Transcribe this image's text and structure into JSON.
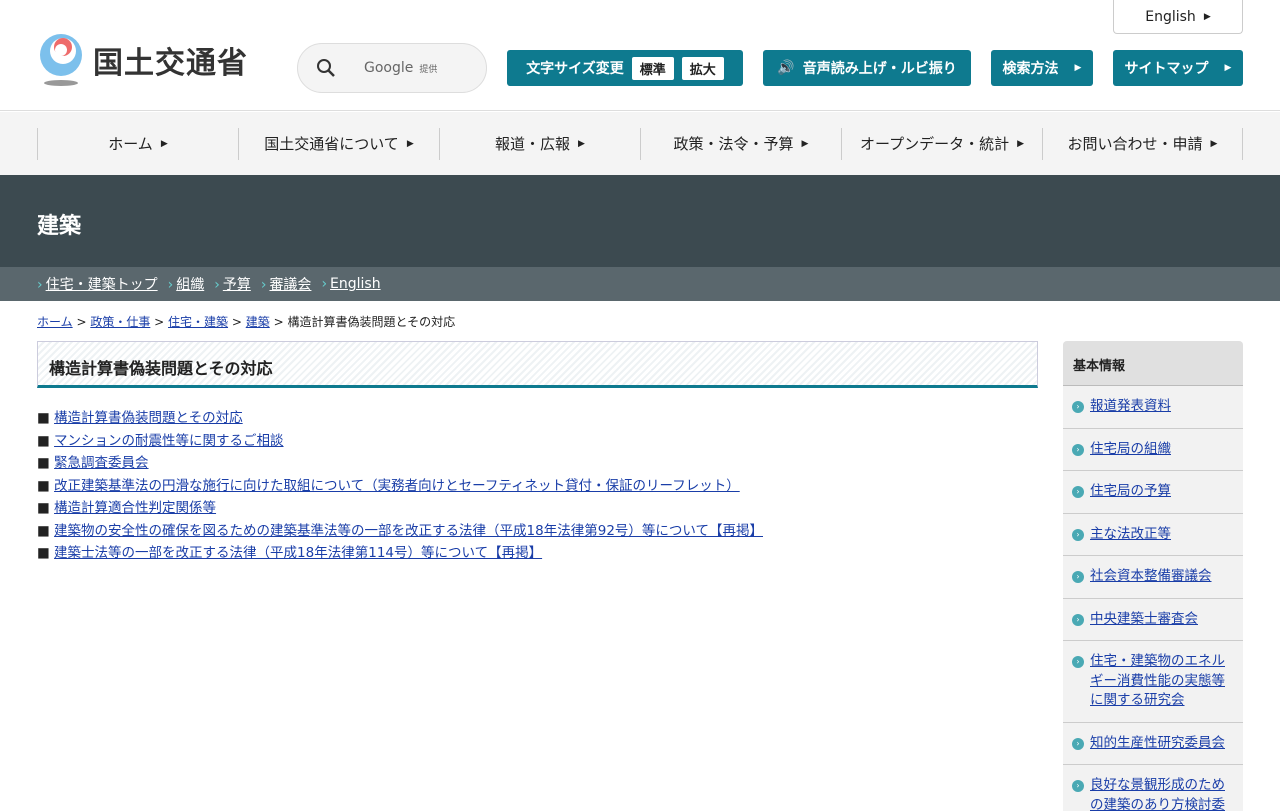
{
  "header": {
    "logo_text": "国土交通省",
    "english": "English",
    "search_brand": "Google",
    "search_provided": "提供",
    "font_size_label": "文字サイズ変更",
    "font_standard": "標準",
    "font_large": "拡大",
    "speech": "音声読み上げ・ルビ振り",
    "search_method": "検索方法",
    "sitemap": "サイトマップ"
  },
  "nav": [
    "ホーム",
    "国土交通省について",
    "報道・広報",
    "政策・法令・予算",
    "オープンデータ・統計",
    "お問い合わせ・申請"
  ],
  "page_title": "建築",
  "subnav": [
    "住宅・建築トップ",
    "組織",
    "予算",
    "審議会",
    "English"
  ],
  "breadcrumb": [
    "ホーム",
    "政策・仕事",
    "住宅・建築",
    "建築"
  ],
  "breadcrumb_current": "構造計算書偽装問題とその対応",
  "heading": "構造計算書偽装問題とその対応",
  "links": [
    "構造計算書偽装問題とその対応",
    "マンションの耐震性等に関するご相談",
    "緊急調査委員会",
    "改正建築基準法の円滑な施行に向けた取組について（実務者向けとセーフティネット貸付・保証のリーフレット）",
    "構造計算適合性判定関係等",
    "建築物の安全性の確保を図るための建築基準法等の一部を改正する法律（平成18年法律第92号）等について【再掲】",
    "建築士法等の一部を改正する法律（平成18年法律第114号）等について【再掲】"
  ],
  "sidebar": {
    "title": "基本情報",
    "items": [
      "報道発表資料",
      "住宅局の組織",
      "住宅局の予算",
      "主な法改正等",
      "社会資本整備審議会",
      "中央建築士審査会",
      "住宅・建築物のエネルギー消費性能の実態等に関する研究会",
      "知的生産性研究委員会",
      "良好な景観形成のための建築のあり方検討委員会"
    ]
  }
}
